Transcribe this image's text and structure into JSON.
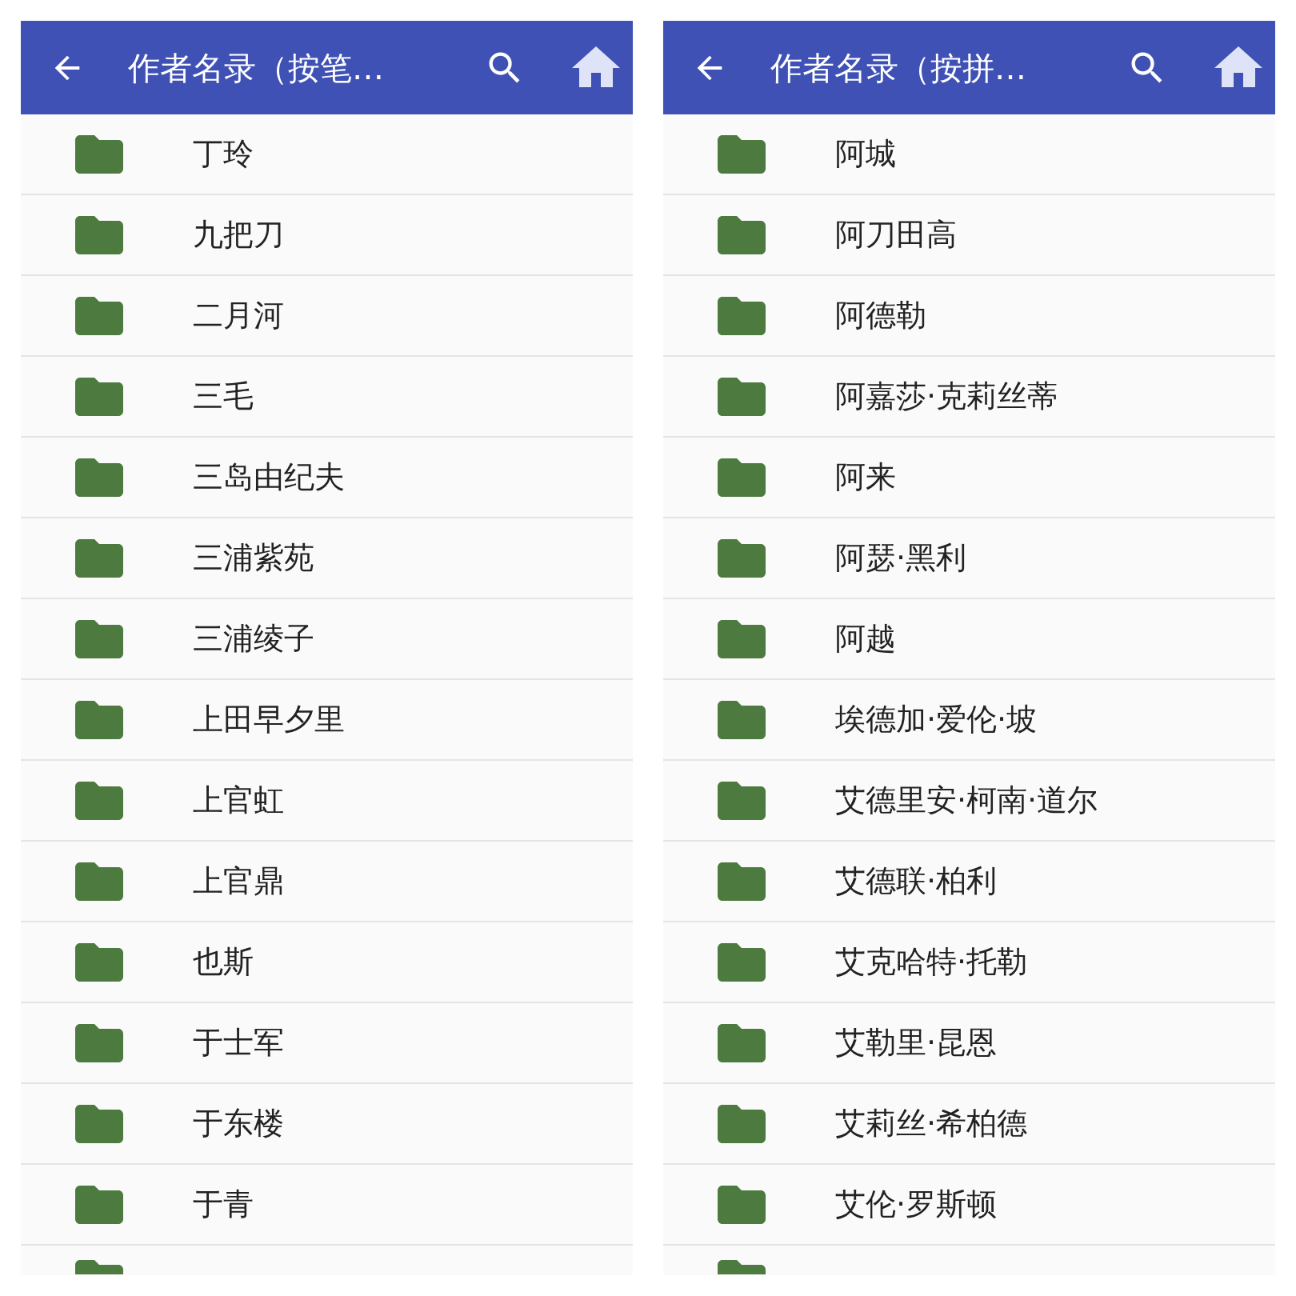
{
  "panels": [
    {
      "title": "作者名录（按笔…",
      "partial_row": true,
      "items": [
        {
          "label": "丁玲"
        },
        {
          "label": "九把刀"
        },
        {
          "label": "二月河"
        },
        {
          "label": "三毛"
        },
        {
          "label": "三岛由纪夫"
        },
        {
          "label": "三浦紫苑"
        },
        {
          "label": "三浦绫子"
        },
        {
          "label": "上田早夕里"
        },
        {
          "label": "上官虹"
        },
        {
          "label": "上官鼎"
        },
        {
          "label": "也斯"
        },
        {
          "label": "于士军"
        },
        {
          "label": "于东楼"
        },
        {
          "label": "于青"
        }
      ]
    },
    {
      "title": "作者名录（按拼…",
      "partial_row": true,
      "items": [
        {
          "label": "阿城"
        },
        {
          "label": "阿刀田高"
        },
        {
          "label": "阿德勒"
        },
        {
          "label": "阿嘉莎·克莉丝蒂"
        },
        {
          "label": "阿来"
        },
        {
          "label": "阿瑟·黑利"
        },
        {
          "label": "阿越"
        },
        {
          "label": "埃德加·爱伦·坡"
        },
        {
          "label": "艾德里安·柯南·道尔"
        },
        {
          "label": "艾德联·柏利"
        },
        {
          "label": "艾克哈特·托勒"
        },
        {
          "label": "艾勒里·昆恩"
        },
        {
          "label": "艾莉丝·希柏德"
        },
        {
          "label": "艾伦·罗斯顿"
        }
      ]
    }
  ]
}
